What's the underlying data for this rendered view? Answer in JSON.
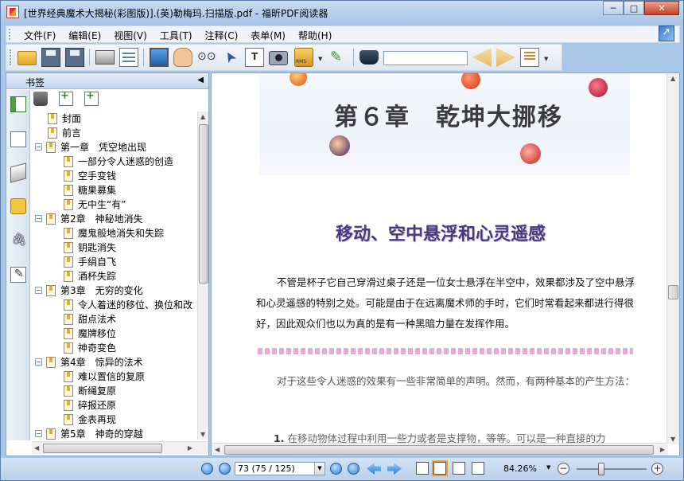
{
  "window": {
    "title": "[世界经典魔术大揭秘(彩图版)].(英)勒梅玛.扫描版.pdf - 福昕PDF阅读器",
    "minimize_label": "─",
    "maximize_label": "□",
    "close_label": "✕"
  },
  "menubar": {
    "items": [
      "文件(F)",
      "编辑(E)",
      "视图(V)",
      "工具(T)",
      "注释(C)",
      "表单(M)",
      "帮助(H)"
    ]
  },
  "toolbar": {
    "search_value": "",
    "icons": [
      "open-icon",
      "save-icon",
      "save-as-icon",
      "print-icon",
      "properties-icon",
      "fullscreen-icon",
      "hand-tool-icon",
      "zoom-tool-icon",
      "select-arrow-icon",
      "text-select-icon",
      "snapshot-icon",
      "rms-icon",
      "sign-icon",
      "find-icon",
      "prev-result-icon",
      "next-result-icon",
      "search-options-icon"
    ]
  },
  "bookmarks": {
    "header": "书签",
    "collapse_glyph": "◀",
    "items": [
      {
        "label": "封面",
        "level": 1,
        "expander": ""
      },
      {
        "label": "前言",
        "level": 1,
        "expander": ""
      },
      {
        "label": "第一章　凭空地出现",
        "level": 0,
        "expander": "−"
      },
      {
        "label": "一部分令人迷惑的创造",
        "level": 2,
        "expander": ""
      },
      {
        "label": "空手变钱",
        "level": 2,
        "expander": ""
      },
      {
        "label": "糖果募集",
        "level": 2,
        "expander": ""
      },
      {
        "label": "无中生“有”",
        "level": 2,
        "expander": ""
      },
      {
        "label": "第2章　神秘地消失",
        "level": 0,
        "expander": "−"
      },
      {
        "label": "魔鬼般地消失和失踪",
        "level": 2,
        "expander": ""
      },
      {
        "label": "钥匙消失",
        "level": 2,
        "expander": ""
      },
      {
        "label": "手绢自飞",
        "level": 2,
        "expander": ""
      },
      {
        "label": "酒杯失踪",
        "level": 2,
        "expander": ""
      },
      {
        "label": "第3章　无穷的变化",
        "level": 0,
        "expander": "−"
      },
      {
        "label": "令人着迷的移位、换位和改",
        "level": 2,
        "expander": ""
      },
      {
        "label": "甜点法术",
        "level": 2,
        "expander": ""
      },
      {
        "label": "魔牌移位",
        "level": 2,
        "expander": ""
      },
      {
        "label": "神奇变色",
        "level": 2,
        "expander": ""
      },
      {
        "label": "第4章　惊异的法术",
        "level": 0,
        "expander": "−"
      },
      {
        "label": "难以置信的复原",
        "level": 2,
        "expander": ""
      },
      {
        "label": "断绳复原",
        "level": 2,
        "expander": ""
      },
      {
        "label": "碎报还原",
        "level": 2,
        "expander": ""
      },
      {
        "label": "金表再现",
        "level": 2,
        "expander": ""
      },
      {
        "label": "第5章　神奇的穿越",
        "level": 0,
        "expander": "−"
      }
    ]
  },
  "document": {
    "chapter_title": "第６章　乾坤大挪移",
    "section_title": "移动、空中悬浮和心灵遥感",
    "para1": "不管是杯子它自己穿滑过桌子还是一位女士悬浮在半空中，效果都涉及了空中悬浮和心灵遥感的特别之处。可能是由于在远离魔术师的手时，它们时常看起来都进行得很好，因此观众们也以为真的是有一种黑暗力量在发挥作用。",
    "para2": "对于这些令人迷惑的效果有一些非常简单的声明。然而，有两种基本的产生方法：",
    "para3_num": "1.",
    "para3": "在移动物体过程中利用一些力或者是支撑物，等等。可以是一种直接的力"
  },
  "statusbar": {
    "page_field": "73 (75 / 125)",
    "zoom": "84.26%",
    "zoom_level_fraction": 0.35
  }
}
